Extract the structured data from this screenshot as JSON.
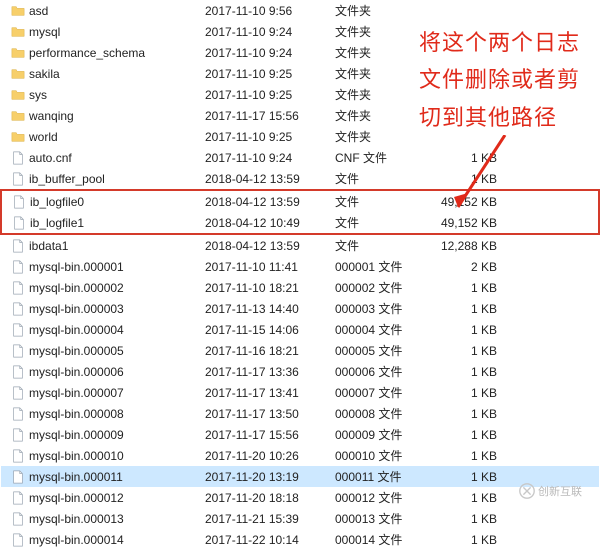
{
  "annotation": {
    "line1": "将这个两个日志",
    "line2": "文件删除或者剪",
    "line3": "切到其他路径"
  },
  "watermark": "创新互联",
  "rows": [
    {
      "icon": "folder",
      "name": "asd",
      "date": "2017-11-10 9:56",
      "type": "文件夹",
      "size": "",
      "hl": false,
      "sel": false
    },
    {
      "icon": "folder",
      "name": "mysql",
      "date": "2017-11-10 9:24",
      "type": "文件夹",
      "size": "",
      "hl": false,
      "sel": false
    },
    {
      "icon": "folder",
      "name": "performance_schema",
      "date": "2017-11-10 9:24",
      "type": "文件夹",
      "size": "",
      "hl": false,
      "sel": false
    },
    {
      "icon": "folder",
      "name": "sakila",
      "date": "2017-11-10 9:25",
      "type": "文件夹",
      "size": "",
      "hl": false,
      "sel": false
    },
    {
      "icon": "folder",
      "name": "sys",
      "date": "2017-11-10 9:25",
      "type": "文件夹",
      "size": "",
      "hl": false,
      "sel": false
    },
    {
      "icon": "folder",
      "name": "wanqing",
      "date": "2017-11-17 15:56",
      "type": "文件夹",
      "size": "",
      "hl": false,
      "sel": false
    },
    {
      "icon": "folder",
      "name": "world",
      "date": "2017-11-10 9:25",
      "type": "文件夹",
      "size": "",
      "hl": false,
      "sel": false
    },
    {
      "icon": "file",
      "name": "auto.cnf",
      "date": "2017-11-10 9:24",
      "type": "CNF 文件",
      "size": "1 KB",
      "hl": false,
      "sel": false
    },
    {
      "icon": "file",
      "name": "ib_buffer_pool",
      "date": "2018-04-12 13:59",
      "type": "文件",
      "size": "1 KB",
      "hl": false,
      "sel": false
    },
    {
      "icon": "file",
      "name": "ib_logfile0",
      "date": "2018-04-12 13:59",
      "type": "文件",
      "size": "49,152 KB",
      "hl": true,
      "sel": false
    },
    {
      "icon": "file",
      "name": "ib_logfile1",
      "date": "2018-04-12 10:49",
      "type": "文件",
      "size": "49,152 KB",
      "hl": true,
      "sel": false
    },
    {
      "icon": "file",
      "name": "ibdata1",
      "date": "2018-04-12 13:59",
      "type": "文件",
      "size": "12,288 KB",
      "hl": false,
      "sel": false
    },
    {
      "icon": "file",
      "name": "mysql-bin.000001",
      "date": "2017-11-10 11:41",
      "type": "000001 文件",
      "size": "2 KB",
      "hl": false,
      "sel": false
    },
    {
      "icon": "file",
      "name": "mysql-bin.000002",
      "date": "2017-11-10 18:21",
      "type": "000002 文件",
      "size": "1 KB",
      "hl": false,
      "sel": false
    },
    {
      "icon": "file",
      "name": "mysql-bin.000003",
      "date": "2017-11-13 14:40",
      "type": "000003 文件",
      "size": "1 KB",
      "hl": false,
      "sel": false
    },
    {
      "icon": "file",
      "name": "mysql-bin.000004",
      "date": "2017-11-15 14:06",
      "type": "000004 文件",
      "size": "1 KB",
      "hl": false,
      "sel": false
    },
    {
      "icon": "file",
      "name": "mysql-bin.000005",
      "date": "2017-11-16 18:21",
      "type": "000005 文件",
      "size": "1 KB",
      "hl": false,
      "sel": false
    },
    {
      "icon": "file",
      "name": "mysql-bin.000006",
      "date": "2017-11-17 13:36",
      "type": "000006 文件",
      "size": "1 KB",
      "hl": false,
      "sel": false
    },
    {
      "icon": "file",
      "name": "mysql-bin.000007",
      "date": "2017-11-17 13:41",
      "type": "000007 文件",
      "size": "1 KB",
      "hl": false,
      "sel": false
    },
    {
      "icon": "file",
      "name": "mysql-bin.000008",
      "date": "2017-11-17 13:50",
      "type": "000008 文件",
      "size": "1 KB",
      "hl": false,
      "sel": false
    },
    {
      "icon": "file",
      "name": "mysql-bin.000009",
      "date": "2017-11-17 15:56",
      "type": "000009 文件",
      "size": "1 KB",
      "hl": false,
      "sel": false
    },
    {
      "icon": "file",
      "name": "mysql-bin.000010",
      "date": "2017-11-20 10:26",
      "type": "000010 文件",
      "size": "1 KB",
      "hl": false,
      "sel": false
    },
    {
      "icon": "file",
      "name": "mysql-bin.000011",
      "date": "2017-11-20 13:19",
      "type": "000011 文件",
      "size": "1 KB",
      "hl": false,
      "sel": true
    },
    {
      "icon": "file",
      "name": "mysql-bin.000012",
      "date": "2017-11-20 18:18",
      "type": "000012 文件",
      "size": "1 KB",
      "hl": false,
      "sel": false
    },
    {
      "icon": "file",
      "name": "mysql-bin.000013",
      "date": "2017-11-21 15:39",
      "type": "000013 文件",
      "size": "1 KB",
      "hl": false,
      "sel": false
    },
    {
      "icon": "file",
      "name": "mysql-bin.000014",
      "date": "2017-11-22 10:14",
      "type": "000014 文件",
      "size": "1 KB",
      "hl": false,
      "sel": false
    }
  ]
}
